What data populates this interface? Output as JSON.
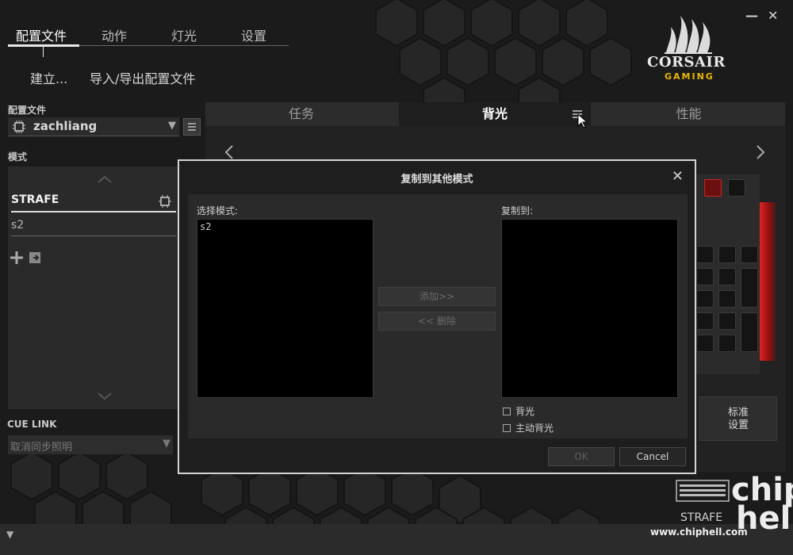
{
  "top_nav": {
    "tabs": [
      "配置文件",
      "动作",
      "灯光",
      "设置"
    ],
    "active_tab": "配置文件"
  },
  "sub_nav": {
    "create": "建立...",
    "import_export": "导入/导出配置文件"
  },
  "brand": {
    "name": "CORSAIR",
    "sub": "GAMING",
    "sub_color": "#e8b800"
  },
  "profile": {
    "label": "配置文件",
    "name": "zachliang"
  },
  "mode": {
    "label": "模式",
    "items": [
      "STRAFE",
      "s2"
    ],
    "active": "STRAFE"
  },
  "cue_link": {
    "label": "CUE LINK",
    "select_value": "取消同步照明"
  },
  "main_tabs": {
    "items": [
      "任务",
      "背光",
      "性能"
    ],
    "active": "背光"
  },
  "standard_button": {
    "line1": "标准",
    "line2": "设置"
  },
  "dialog": {
    "title": "复制到其他模式",
    "select_mode_label": "选择模式:",
    "copy_to_label": "复制到:",
    "source_items": [
      "s2"
    ],
    "add_button": "添加>>",
    "remove_button": "<< 删除",
    "checkboxes": [
      "背光",
      "主动背光"
    ],
    "ok_button": "OK",
    "cancel_button": "Cancel"
  },
  "device": {
    "name": "STRAFE"
  },
  "watermark": {
    "url": "www.chiphell.com",
    "logo_line1": "chip",
    "logo_line2": "hell"
  },
  "icons": [
    "close-icon",
    "minimize-icon",
    "chevron-left-icon",
    "chevron-right-icon",
    "chevron-up-icon",
    "chevron-down-icon",
    "chip-icon",
    "menu-icon",
    "plus-icon",
    "import-icon",
    "mouse-cursor-icon"
  ],
  "colors": {
    "accent_red": "#d22222",
    "background": "#1b1b1b"
  }
}
